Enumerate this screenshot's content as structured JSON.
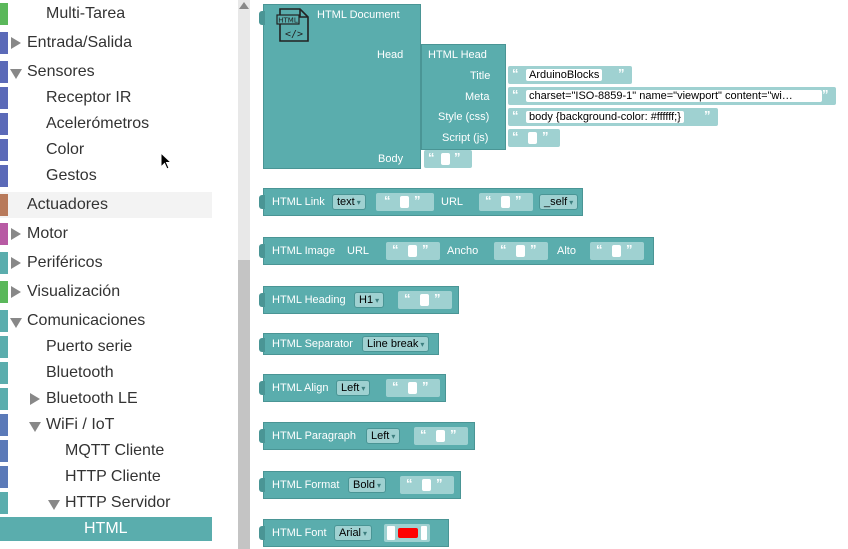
{
  "sidebar": {
    "items": [
      {
        "label": "Multi-Tarea",
        "color": "#5bb85b"
      },
      {
        "label": "Entrada/Salida",
        "color": "#5b6ab8"
      },
      {
        "label": "Sensores",
        "color": "#5b6ab8"
      },
      {
        "label": "Receptor IR",
        "color": "#5b6ab8"
      },
      {
        "label": "Acelerómetros",
        "color": "#5b6ab8"
      },
      {
        "label": "Color",
        "color": "#5b6ab8"
      },
      {
        "label": "Gestos",
        "color": "#5b6ab8"
      },
      {
        "label": "Actuadores",
        "color": "#b87a5b"
      },
      {
        "label": "Motor",
        "color": "#b85ba4"
      },
      {
        "label": "Periféricos",
        "color": "#5badad"
      },
      {
        "label": "Visualización",
        "color": "#5bb85b"
      },
      {
        "label": "Comunicaciones",
        "color": "#5badad"
      },
      {
        "label": "Puerto serie",
        "color": "#5badad"
      },
      {
        "label": "Bluetooth",
        "color": "#5badad"
      },
      {
        "label": "Bluetooth LE",
        "color": "#5badad"
      },
      {
        "label": "WiFi / IoT",
        "color": "#5b7ab8"
      },
      {
        "label": "MQTT Cliente",
        "color": "#5b7ab8"
      },
      {
        "label": "HTTP Cliente",
        "color": "#5b7ab8"
      },
      {
        "label": "HTTP Servidor",
        "color": "#5badad"
      },
      {
        "label": "HTML",
        "color": "#5badad"
      }
    ]
  },
  "blocks": {
    "doc": {
      "title": "HTML Document",
      "icon_text": "HTML",
      "head_label": "Head",
      "body_label": "Body"
    },
    "head": {
      "title": "HTML Head",
      "title_label": "Title",
      "title_value": "ArduinoBlocks",
      "meta_label": "Meta",
      "meta_value": "charset=\"ISO-8859-1\" name=\"viewport\" content=\"wi…",
      "style_label": "Style (css)",
      "style_value": "body {background-color: #ffffff;}",
      "script_label": "Script (js)"
    },
    "link": {
      "title": "HTML Link",
      "type": "text",
      "url_label": "URL",
      "target": "_self"
    },
    "image": {
      "title": "HTML Image",
      "url_label": "URL",
      "width_label": "Ancho",
      "height_label": "Alto"
    },
    "heading": {
      "title": "HTML Heading",
      "level": "H1"
    },
    "separator": {
      "title": "HTML Separator",
      "type": "Line break"
    },
    "align": {
      "title": "HTML Align",
      "value": "Left"
    },
    "paragraph": {
      "title": "HTML Paragraph",
      "value": "Left"
    },
    "format": {
      "title": "HTML Format",
      "value": "Bold"
    },
    "font": {
      "title": "HTML Font",
      "value": "Arial",
      "color": "#ff0000"
    }
  },
  "glyphs": {
    "open_quote": "“",
    "close_quote": "”",
    "dropdown_arrow": "▾"
  }
}
